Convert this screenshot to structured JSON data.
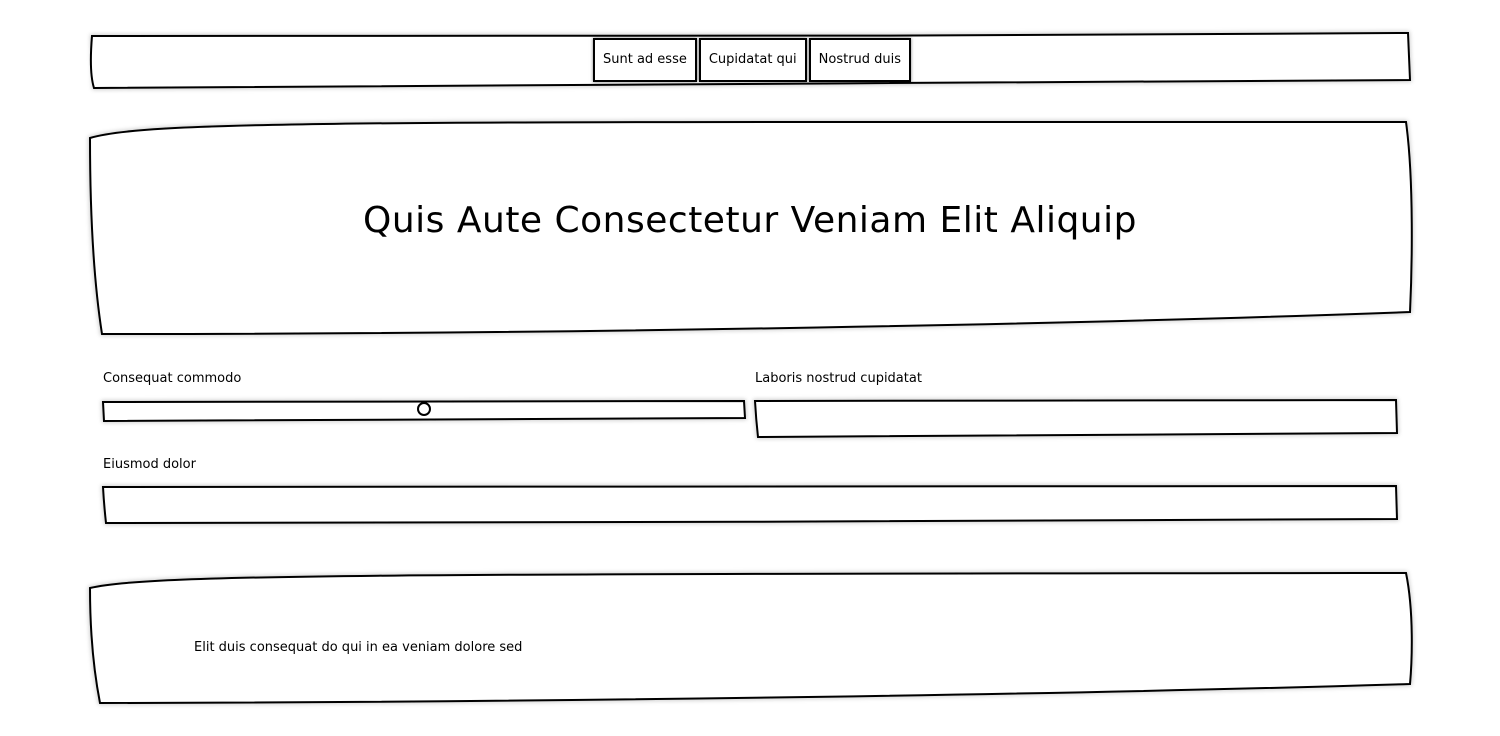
{
  "nav": {
    "items": [
      "Sunt ad esse",
      "Cupidatat qui",
      "Nostrud duis"
    ]
  },
  "hero": {
    "title": "Quis Aute Consectetur Veniam Elit Aliquip"
  },
  "form": {
    "slider_label": "Consequat commodo",
    "slider_value": 0.5,
    "field1_label": "Laboris nostrud cupidatat",
    "field1_value": "",
    "field2_label": "Eiusmod dolor",
    "field2_value": ""
  },
  "footer": {
    "text": "Elit duis consequat do qui in ea veniam dolore sed"
  }
}
